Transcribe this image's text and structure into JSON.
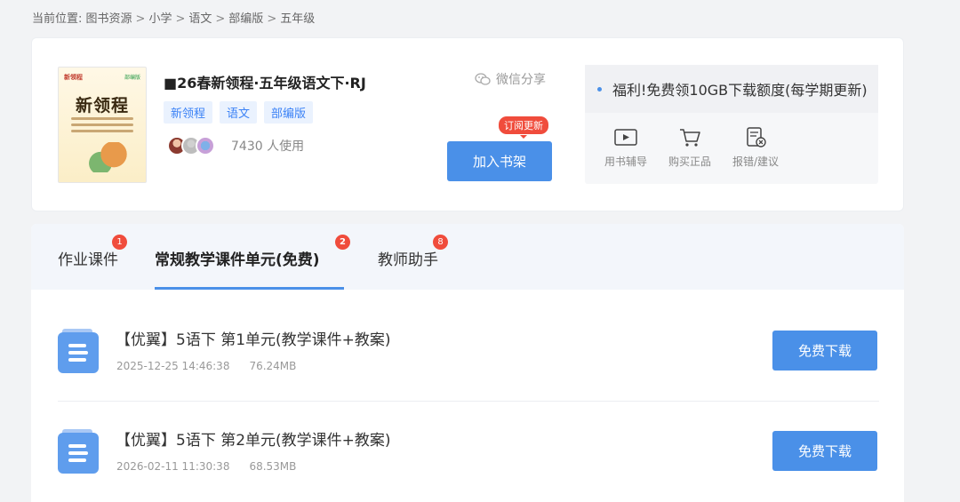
{
  "breadcrumb": {
    "prefix": "当前位置:",
    "items": [
      "图书资源",
      "小学",
      "语文",
      "部编版",
      "五年级"
    ]
  },
  "book": {
    "title": "■26春新领程·五年级语文下·RJ",
    "tags": [
      "新领程",
      "语文",
      "部编版"
    ],
    "user_count": "7430 人使用",
    "share_label": "微信分享",
    "add_button": "加入书架",
    "subscribe_badge": "订阅更新",
    "cover": {
      "title": "新领程"
    }
  },
  "side_panel": {
    "welfare_text": "福利!免费领10GB下载额度(每学期更新)",
    "tools": [
      {
        "label": "用书辅导",
        "icon": "video-play-icon"
      },
      {
        "label": "购买正品",
        "icon": "shopping-cart-icon"
      },
      {
        "label": "报错/建议",
        "icon": "report-error-icon"
      }
    ]
  },
  "tabs": [
    {
      "label": "作业课件",
      "badge": "1",
      "active": false
    },
    {
      "label": "常规教学课件单元(免费)",
      "badge": "2",
      "active": true
    },
    {
      "label": "教师助手",
      "badge": "8",
      "active": false
    }
  ],
  "resources": [
    {
      "title": "【优翼】5语下 第1单元(教学课件+教案)",
      "date": "2025-12-25 14:46:38",
      "size": "76.24MB",
      "button": "免费下载"
    },
    {
      "title": "【优翼】5语下 第2单元(教学课件+教案)",
      "date": "2026-02-11 11:30:38",
      "size": "68.53MB",
      "button": "免费下载"
    }
  ],
  "colors": {
    "accent": "#4a90e8",
    "badge": "#f04c3c",
    "tag_bg": "#eaf2fe"
  }
}
